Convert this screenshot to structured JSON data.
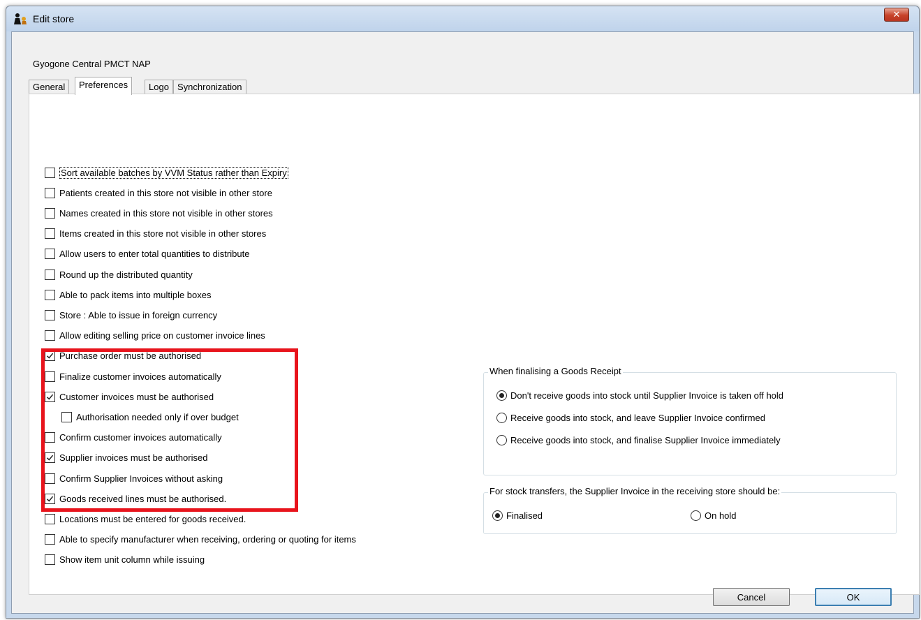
{
  "window": {
    "title": "Edit store",
    "close_label": "✕"
  },
  "store_name": "Gyogone Central PMCT NAP",
  "tabs": [
    {
      "label": "General",
      "active": false
    },
    {
      "label": "Preferences",
      "active": true
    },
    {
      "label": "Logo",
      "active": false
    },
    {
      "label": "Synchronization",
      "active": false
    }
  ],
  "preferences": [
    {
      "label": "Sort available batches by VVM Status rather than Expiry",
      "checked": false
    },
    {
      "label": "Patients created in this store not visible in other store",
      "checked": false
    },
    {
      "label": "Names created in this store not visible in other stores",
      "checked": false
    },
    {
      "label": "Items created in this store not visible in other stores",
      "checked": false
    },
    {
      "label": "Allow users to enter total quantities to distribute",
      "checked": false
    },
    {
      "label": "Round up the distributed quantity",
      "checked": false
    },
    {
      "label": "Able to pack items into multiple boxes",
      "checked": false
    },
    {
      "label": "Store : Able to issue in foreign currency",
      "checked": false
    },
    {
      "label": "Allow editing selling price on customer invoice lines",
      "checked": false
    },
    {
      "label": "Purchase order must be authorised",
      "checked": true
    },
    {
      "label": "Finalize customer invoices automatically",
      "checked": false
    },
    {
      "label": "Customer invoices must be authorised",
      "checked": true
    },
    {
      "label": "Authorisation needed only if over budget",
      "checked": false
    },
    {
      "label": "Confirm customer invoices automatically",
      "checked": false
    },
    {
      "label": "Supplier invoices must be authorised",
      "checked": true
    },
    {
      "label": "Confirm Supplier Invoices without asking",
      "checked": false
    },
    {
      "label": "Goods received lines must be authorised.",
      "checked": true
    },
    {
      "label": "Locations must be entered for goods received.",
      "checked": false
    },
    {
      "label": "Able to specify manufacturer when receiving, ordering or quoting for items",
      "checked": false
    },
    {
      "label": "Show item unit column while issuing",
      "checked": false
    }
  ],
  "goods_receipt_group": {
    "title": "When finalising a Goods Receipt",
    "options": [
      {
        "label": "Don't receive goods into stock until Supplier Invoice is taken off hold",
        "selected": true
      },
      {
        "label": "Receive goods into stock, and leave Supplier Invoice confirmed",
        "selected": false
      },
      {
        "label": "Receive goods into stock, and finalise Supplier Invoice immediately",
        "selected": false
      }
    ]
  },
  "stock_transfer_group": {
    "title": "For stock transfers, the Supplier Invoice in the receiving store should be:",
    "options": [
      {
        "label": "Finalised",
        "selected": true
      },
      {
        "label": "On hold",
        "selected": false
      }
    ]
  },
  "buttons": {
    "cancel": "Cancel",
    "ok": "OK"
  },
  "colors": {
    "highlight": "#e8141c",
    "default_button_border": "#3c7fb1"
  }
}
